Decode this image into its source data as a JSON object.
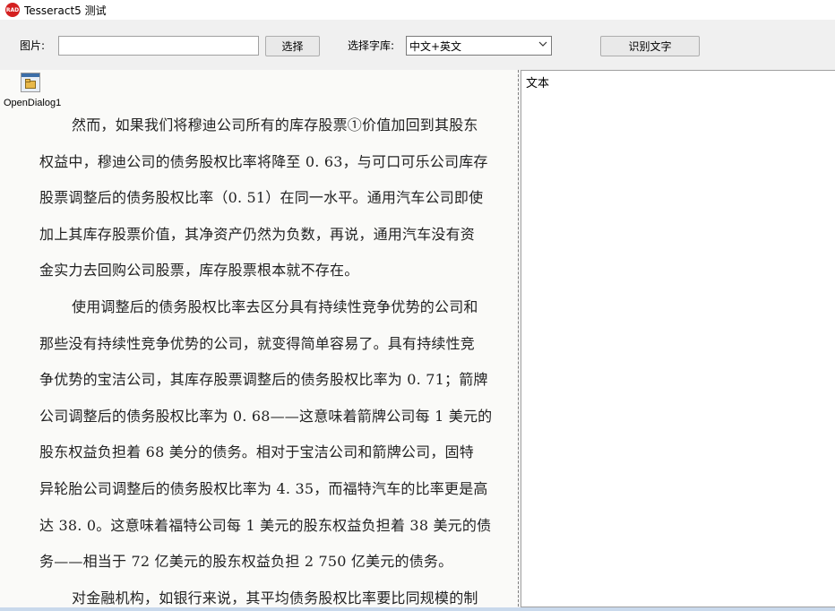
{
  "window": {
    "title": "Tesseract5 测试",
    "icon_text": "RAD"
  },
  "toolbar": {
    "image_label": "图片:",
    "image_path": "",
    "choose_button": "选择",
    "lang_label": "选择字库:",
    "lang_selected": "中文+英文",
    "recognize_button": "识别文字"
  },
  "dialog": {
    "caption": "OpenDialog1"
  },
  "page_lines": [
    "然而，如果我们将穆迪公司所有的库存股票①价值加回到其股东",
    "权益中，穆迪公司的债务股权比率将降至 0. 63，与可口可乐公司库存",
    "股票调整后的债务股权比率（0. 51）在同一水平。通用汽车公司即使",
    "加上其库存股票价值，其净资产仍然为负数，再说，通用汽车没有资",
    "金实力去回购公司股票，库存股票根本就不存在。",
    "使用调整后的债务股权比率去区分具有持续性竞争优势的公司和",
    "那些没有持续性竞争优势的公司，就变得简单容易了。具有持续性竞",
    "争优势的宝洁公司，其库存股票调整后的债务股权比率为 0. 71；箭牌",
    "公司调整后的债务股权比率为 0. 68——这意味着箭牌公司每 1 美元的",
    "股东权益负担着 68 美分的债务。相对于宝洁公司和箭牌公司，固特",
    "异轮胎公司调整后的债务股权比率为 4. 35，而福特汽车的比率更是高",
    "达 38. 0。这意味着福特公司每 1 美元的股东权益负担着 38 美元的债",
    "务——相当于 72 亿美元的股东权益负担 2 750 亿美元的债务。",
    "对金融机构，如银行来说，其平均债务股权比率要比同规模的制"
  ],
  "memo": {
    "text": "文本"
  }
}
